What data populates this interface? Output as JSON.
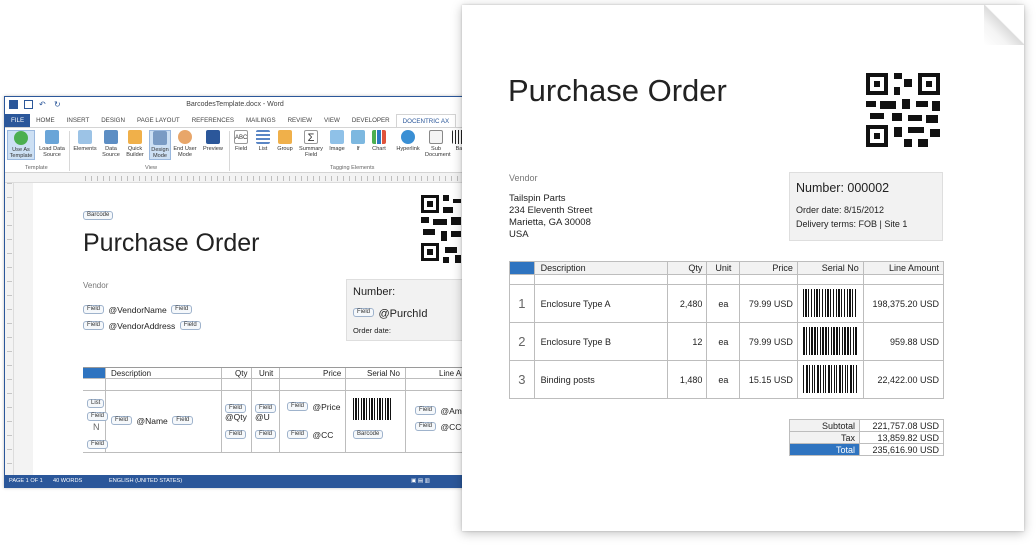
{
  "word": {
    "window_title": "BarcodesTemplate.docx - Word",
    "tabs": [
      "FILE",
      "HOME",
      "INSERT",
      "DESIGN",
      "PAGE LAYOUT",
      "REFERENCES",
      "MAILINGS",
      "REVIEW",
      "VIEW",
      "DEVELOPER",
      "DOCENTRIC AX"
    ],
    "ribbon": {
      "buttons": [
        "Use As Template",
        "Load Data Source",
        "Elements",
        "Data Source",
        "Quick Builder",
        "Design Mode",
        "End User Mode",
        "Preview",
        "Field",
        "List",
        "Group",
        "Summary Field",
        "Image",
        "If",
        "Chart",
        "Hyperlink",
        "Sub Document",
        "Ba"
      ],
      "groups": [
        "Template",
        "View",
        "Tagging Elements"
      ]
    },
    "doc": {
      "barcode_tag": "Barcode",
      "title": "Purchase Order",
      "vendor_label": "Vendor",
      "field": "Field",
      "vendor_name": "@VendorName",
      "vendor_address": "@VendorAddress",
      "number_label": "Number:",
      "purch_id": "@PurchId",
      "order_date_label": "Order date:",
      "table_headers": [
        "Description",
        "Qty",
        "Unit",
        "Price",
        "Serial No",
        "Line Am"
      ],
      "list_tag": "List",
      "n_value": "N",
      "name_field": "@Name",
      "qty_field": "@Qty",
      "unit_field": "@U",
      "price_field": "@Price",
      "cc_field": "@CC",
      "amount_field": "@Amou",
      "cc_field2": "@CC"
    },
    "status": {
      "page": "PAGE 1 OF 1",
      "words": "40 WORDS",
      "language": "ENGLISH (UNITED STATES)"
    }
  },
  "document": {
    "title": "Purchase Order",
    "vendor_label": "Vendor",
    "vendor": [
      "Tailspin Parts",
      "234 Eleventh Street",
      "Marietta, GA 30008",
      "USA"
    ],
    "number_label": "Number: 000002",
    "order_date": "Order date: 8/15/2012",
    "delivery_terms": "Delivery terms: FOB | Site 1",
    "table_headers": [
      "",
      "Description",
      "Qty",
      "Unit",
      "Price",
      "Serial No",
      "Line Amount"
    ],
    "rows": [
      {
        "n": "1",
        "description": "Enclosure Type A",
        "qty": "2,480",
        "unit": "ea",
        "price": "79.99 USD",
        "amount": "198,375.20 USD"
      },
      {
        "n": "2",
        "description": "Enclosure Type B",
        "qty": "12",
        "unit": "ea",
        "price": "79.99 USD",
        "amount": "959.88 USD"
      },
      {
        "n": "3",
        "description": "Binding posts",
        "qty": "1,480",
        "unit": "ea",
        "price": "15.15 USD",
        "amount": "22,422.00 USD"
      }
    ],
    "totals": [
      {
        "label": "Subtotal",
        "value": "221,757.08 USD"
      },
      {
        "label": "Tax",
        "value": "13,859.82 USD"
      },
      {
        "label": "Total",
        "value": "235,616.90 USD"
      }
    ]
  },
  "colors": {
    "word_blue": "#2b579a",
    "accent_blue": "#2f74c0"
  }
}
